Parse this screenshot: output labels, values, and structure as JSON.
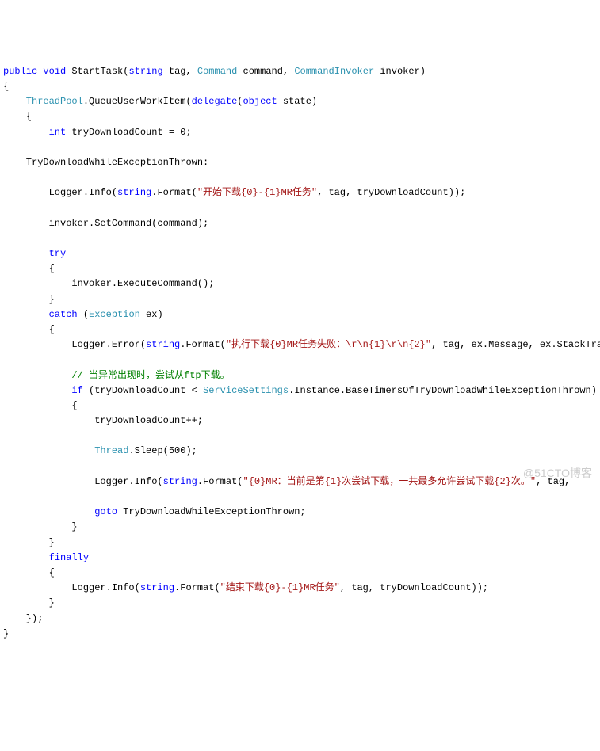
{
  "code": {
    "l1_kw1": "public",
    "l1_kw2": "void",
    "l1_method": " StartTask(",
    "l1_kw3": "string",
    "l1_p1": " tag, ",
    "l1_type1": "Command",
    "l1_p2": " command, ",
    "l1_type2": "CommandInvoker",
    "l1_p3": " invoker)",
    "l2": "{",
    "l3_type": "    ThreadPool",
    "l3_txt1": ".QueueUserWorkItem(",
    "l3_kw": "delegate",
    "l3_txt2": "(",
    "l3_kw2": "object",
    "l3_txt3": " state)",
    "l4": "    {",
    "l5_pre": "        ",
    "l5_kw": "int",
    "l5_txt": " tryDownloadCount = 0;",
    "l6": "    TryDownloadWhileExceptionThrown:",
    "l7_pre": "        Logger.Info(",
    "l7_kw": "string",
    "l7_txt1": ".Format(",
    "l7_str": "\"开始下载{0}-{1}MR任务\"",
    "l7_txt2": ", tag, tryDownloadCount));",
    "l8": "        invoker.SetCommand(command);",
    "l9_pre": "        ",
    "l9_kw": "try",
    "l10": "        {",
    "l11": "            invoker.ExecuteCommand();",
    "l12": "        }",
    "l13_pre": "        ",
    "l13_kw": "catch",
    "l13_txt1": " (",
    "l13_type": "Exception",
    "l13_txt2": " ex)",
    "l14": "        {",
    "l15_pre": "            Logger.Error(",
    "l15_kw": "string",
    "l15_txt1": ".Format(",
    "l15_str": "\"执行下载{0}MR任务失败：\\r\\n{1}\\r\\n{2}\"",
    "l15_txt2": ", tag, ex.Message, ex.StackTra",
    "l16_pre": "            ",
    "l16_comment": "// 当异常出现时，尝试从ftp下载。",
    "l17_pre": "            ",
    "l17_kw": "if",
    "l17_txt1": " (tryDownloadCount < ",
    "l17_type": "ServiceSettings",
    "l17_txt2": ".Instance.BaseTimersOfTryDownloadWhileExceptionThrown)",
    "l18": "            {",
    "l19": "                tryDownloadCount++;",
    "l20_pre": "                ",
    "l20_type": "Thread",
    "l20_txt": ".Sleep(500);",
    "l21_pre": "                Logger.Info(",
    "l21_kw": "string",
    "l21_txt1": ".Format(",
    "l21_str": "\"{0}MR：当前是第{1}次尝试下载，一共最多允许尝试下载{2}次。\"",
    "l21_txt2": ", tag, ",
    "l22_pre": "                ",
    "l22_kw": "goto",
    "l22_txt": " TryDownloadWhileExceptionThrown;",
    "l23": "            }",
    "l24": "        }",
    "l25_pre": "        ",
    "l25_kw": "finally",
    "l26": "        {",
    "l27_pre": "            Logger.Info(",
    "l27_kw": "string",
    "l27_txt1": ".Format(",
    "l27_str": "\"结束下载{0}-{1}MR任务\"",
    "l27_txt2": ", tag, tryDownloadCount));",
    "l28": "        }",
    "l29": "    });",
    "l30": "}"
  },
  "watermark": "@51CTO博客"
}
